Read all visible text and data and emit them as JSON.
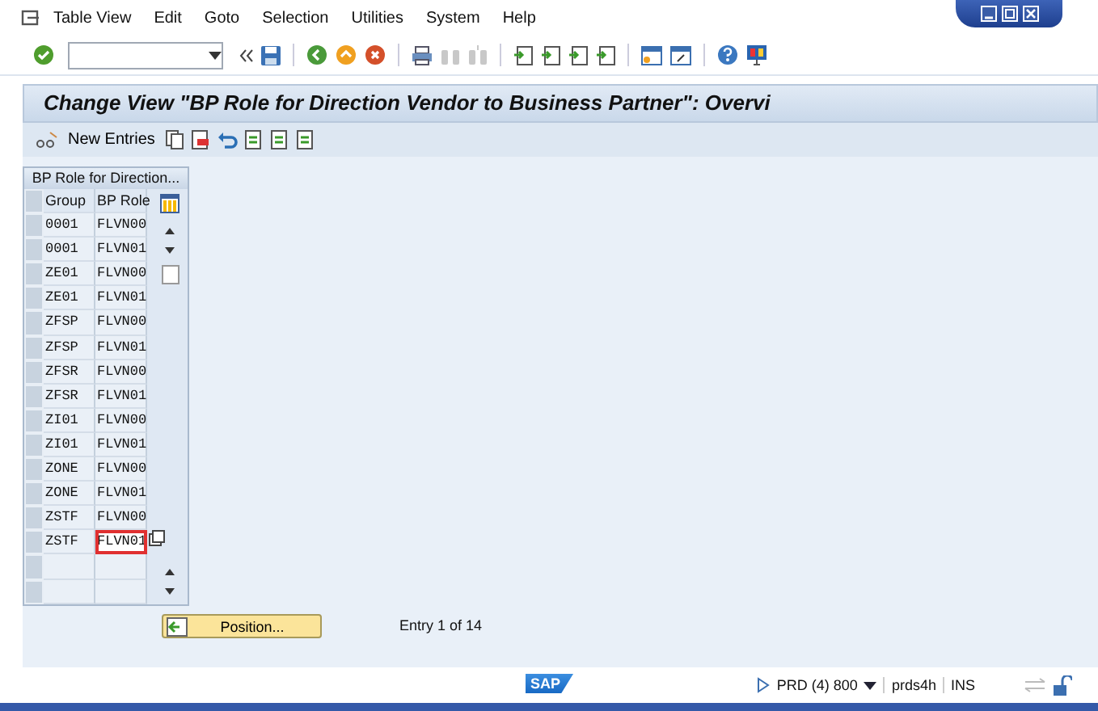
{
  "menu": [
    "Table View",
    "Edit",
    "Goto",
    "Selection",
    "Utilities",
    "System",
    "Help"
  ],
  "title": "Change View \"BP Role for Direction Vendor to Business Partner\": Overvi",
  "app_toolbar": {
    "new_entries": "New Entries"
  },
  "table": {
    "caption": "BP Role for Direction...",
    "columns": [
      "Group",
      "BP Role"
    ],
    "rows": [
      {
        "group": "0001",
        "role": "FLVN00",
        "focused": false
      },
      {
        "group": "0001",
        "role": "FLVN01",
        "focused": false
      },
      {
        "group": "ZE01",
        "role": "FLVN00",
        "focused": false
      },
      {
        "group": "ZE01",
        "role": "FLVN01",
        "focused": false
      },
      {
        "group": "ZFSP",
        "role": "FLVN00",
        "focused": false
      },
      {
        "group": "ZFSP",
        "role": "FLVN01",
        "focused": false
      },
      {
        "group": "ZFSR",
        "role": "FLVN00",
        "focused": false
      },
      {
        "group": "ZFSR",
        "role": "FLVN01",
        "focused": false
      },
      {
        "group": "ZI01",
        "role": "FLVN00",
        "focused": false
      },
      {
        "group": "ZI01",
        "role": "FLVN01",
        "focused": false
      },
      {
        "group": "ZONE",
        "role": "FLVN00",
        "focused": false
      },
      {
        "group": "ZONE",
        "role": "FLVN01",
        "focused": false
      },
      {
        "group": "ZSTF",
        "role": "FLVN00",
        "focused": false
      },
      {
        "group": "ZSTF",
        "role": "FLVN01",
        "focused": true
      }
    ]
  },
  "position_button": "Position...",
  "entry_info": "Entry 1 of 14",
  "status_bar": {
    "logo": "SAP",
    "system": "PRD (4) 800",
    "host": "prds4h",
    "mode": "INS"
  }
}
